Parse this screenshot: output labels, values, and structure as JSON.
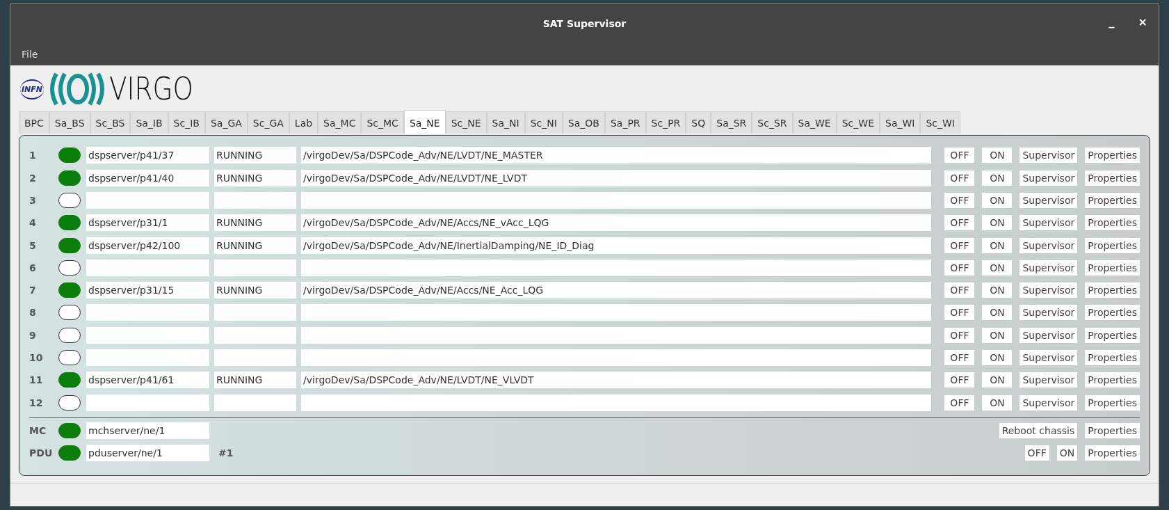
{
  "window": {
    "title": "SAT Supervisor",
    "controls": [
      "_",
      "×"
    ]
  },
  "menu": [
    "File"
  ],
  "logo": {
    "infn": "INFN",
    "virgo": "VIRGO"
  },
  "tabs": [
    {
      "label": "BPC",
      "selected": false
    },
    {
      "label": "Sa_BS",
      "selected": false
    },
    {
      "label": "Sc_BS",
      "selected": false
    },
    {
      "label": "Sa_IB",
      "selected": false
    },
    {
      "label": "Sc_IB",
      "selected": false
    },
    {
      "label": "Sa_GA",
      "selected": false
    },
    {
      "label": "Sc_GA",
      "selected": false
    },
    {
      "label": "Lab",
      "selected": false
    },
    {
      "label": "Sa_MC",
      "selected": false
    },
    {
      "label": "Sc_MC",
      "selected": false
    },
    {
      "label": "Sa_NE",
      "selected": true
    },
    {
      "label": "Sc_NE",
      "selected": false
    },
    {
      "label": "Sa_NI",
      "selected": false
    },
    {
      "label": "Sc_NI",
      "selected": false
    },
    {
      "label": "Sa_OB",
      "selected": false
    },
    {
      "label": "Sa_PR",
      "selected": false
    },
    {
      "label": "Sc_PR",
      "selected": false
    },
    {
      "label": "SQ",
      "selected": false
    },
    {
      "label": "Sa_SR",
      "selected": false
    },
    {
      "label": "Sc_SR",
      "selected": false
    },
    {
      "label": "Sa_WE",
      "selected": false
    },
    {
      "label": "Sc_WE",
      "selected": false
    },
    {
      "label": "Sa_WI",
      "selected": false
    },
    {
      "label": "Sc_WI",
      "selected": false
    }
  ],
  "rows": [
    {
      "number": "1",
      "on": true,
      "server": "dspserver/p41/37",
      "status": "RUNNING",
      "path": "/virgoDev/Sa/DSPCode_Adv/NE/LVDT/NE_MASTER",
      "buttons": [
        "OFF",
        "ON",
        "Supervisor",
        "Properties"
      ]
    },
    {
      "number": "2",
      "on": true,
      "server": "dspserver/p41/40",
      "status": "RUNNING",
      "path": "/virgoDev/Sa/DSPCode_Adv/NE/LVDT/NE_LVDT",
      "buttons": [
        "OFF",
        "ON",
        "Supervisor",
        "Properties"
      ]
    },
    {
      "number": "3",
      "on": false,
      "buttons": [
        "OFF",
        "ON",
        "Supervisor",
        "Properties"
      ]
    },
    {
      "number": "4",
      "on": true,
      "server": "dspserver/p31/1",
      "status": "RUNNING",
      "path": "/virgoDev/Sa/DSPCode_Adv/NE/Accs/NE_vAcc_LQG",
      "buttons": [
        "OFF",
        "ON",
        "Supervisor",
        "Properties"
      ]
    },
    {
      "number": "5",
      "on": true,
      "server": "dspserver/p42/100",
      "status": "RUNNING",
      "path": "/virgoDev/Sa/DSPCode_Adv/NE/InertialDamping/NE_ID_Diag",
      "buttons": [
        "OFF",
        "ON",
        "Supervisor",
        "Properties"
      ]
    },
    {
      "number": "6",
      "on": false,
      "buttons": [
        "OFF",
        "ON",
        "Supervisor",
        "Properties"
      ]
    },
    {
      "number": "7",
      "on": true,
      "server": "dspserver/p31/15",
      "status": "RUNNING",
      "path": "/virgoDev/Sa/DSPCode_Adv/NE/Accs/NE_Acc_LQG",
      "buttons": [
        "OFF",
        "ON",
        "Supervisor",
        "Properties"
      ]
    },
    {
      "number": "8",
      "on": false,
      "buttons": [
        "OFF",
        "ON",
        "Supervisor",
        "Properties"
      ]
    },
    {
      "number": "9",
      "on": false,
      "buttons": [
        "OFF",
        "ON",
        "Supervisor",
        "Properties"
      ]
    },
    {
      "number": "10",
      "on": false,
      "buttons": [
        "OFF",
        "ON",
        "Supervisor",
        "Properties"
      ]
    },
    {
      "number": "11",
      "on": true,
      "server": "dspserver/p41/61",
      "status": "RUNNING",
      "path": "/virgoDev/Sa/DSPCode_Adv/NE/LVDT/NE_VLVDT",
      "buttons": [
        "OFF",
        "ON",
        "Supervisor",
        "Properties"
      ]
    },
    {
      "number": "12",
      "on": false,
      "buttons": [
        "OFF",
        "ON",
        "Supervisor",
        "Properties"
      ]
    }
  ],
  "devices": [
    {
      "label": "MC",
      "on": true,
      "server": "mchserver/ne/1",
      "buttons": [
        "Reboot chassis",
        "Properties"
      ]
    },
    {
      "label": "PDU",
      "on": true,
      "server": "pduserver/ne/1",
      "tag": "#1",
      "buttons": [
        "OFF",
        "ON",
        "Properties"
      ]
    }
  ]
}
